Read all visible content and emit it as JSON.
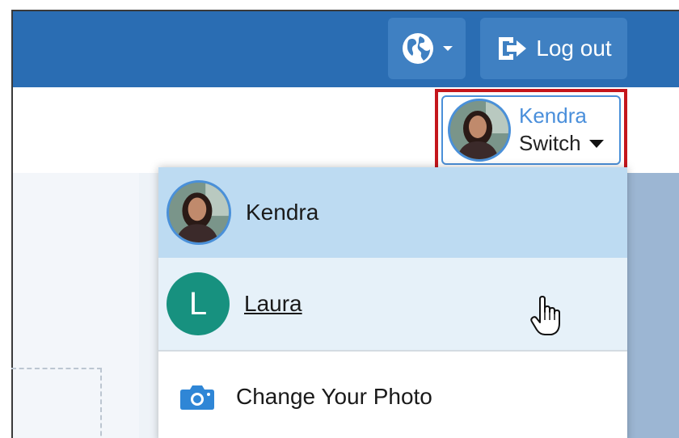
{
  "topbar": {
    "globe_icon": "globe-icon",
    "logout_label": "Log out",
    "colors": {
      "bar": "#2a6db3",
      "button": "#3f80c2"
    }
  },
  "user_switcher": {
    "current_user": "Kendra",
    "switch_label": "Switch"
  },
  "dropdown": {
    "items": [
      {
        "label": "Kendra",
        "type": "photo-avatar",
        "state": "selected"
      },
      {
        "label": "Laura",
        "type": "letter-avatar",
        "initial": "L",
        "state": "hover"
      },
      {
        "label": "Change Your Photo",
        "type": "action",
        "icon": "camera-icon"
      }
    ],
    "colors": {
      "selected": "#bddbf2",
      "hover": "#e6f1f9",
      "laura_avatar": "#17917f"
    }
  }
}
